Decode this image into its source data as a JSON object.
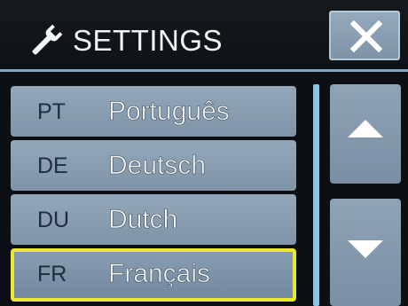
{
  "header": {
    "title": "SETTINGS",
    "icon": "wrench-icon",
    "close_icon": "close-icon"
  },
  "languages": [
    {
      "code": "PT",
      "name": "Português",
      "selected": false
    },
    {
      "code": "DE",
      "name": "Deutsch",
      "selected": false
    },
    {
      "code": "DU",
      "name": "Dutch",
      "selected": false
    },
    {
      "code": "FR",
      "name": "Français",
      "selected": true
    }
  ],
  "scroll": {
    "up_icon": "triangle-up-icon",
    "down_icon": "triangle-down-icon"
  },
  "colors": {
    "background": "#0c0f13",
    "button": "#8599ad",
    "selection_border": "#e8e830",
    "scrollbar": "#86c6e8",
    "divider": "#7fa6c4"
  }
}
